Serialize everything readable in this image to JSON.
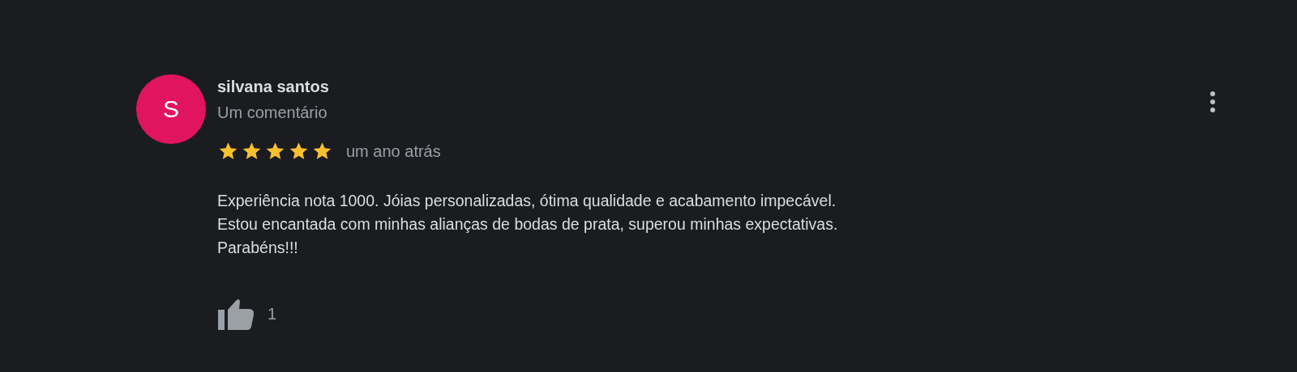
{
  "review": {
    "avatar_letter": "S",
    "author": "silvana santos",
    "subtitle": "Um comentário",
    "stars": 5,
    "time": "um ano atrás",
    "text": "Experiência nota 1000. Jóias personalizadas, ótima qualidade e acabamento impecável.\nEstou encantada com minhas alianças de bodas de prata, superou minhas expectativas.\nParabéns!!!",
    "likes": "1"
  }
}
